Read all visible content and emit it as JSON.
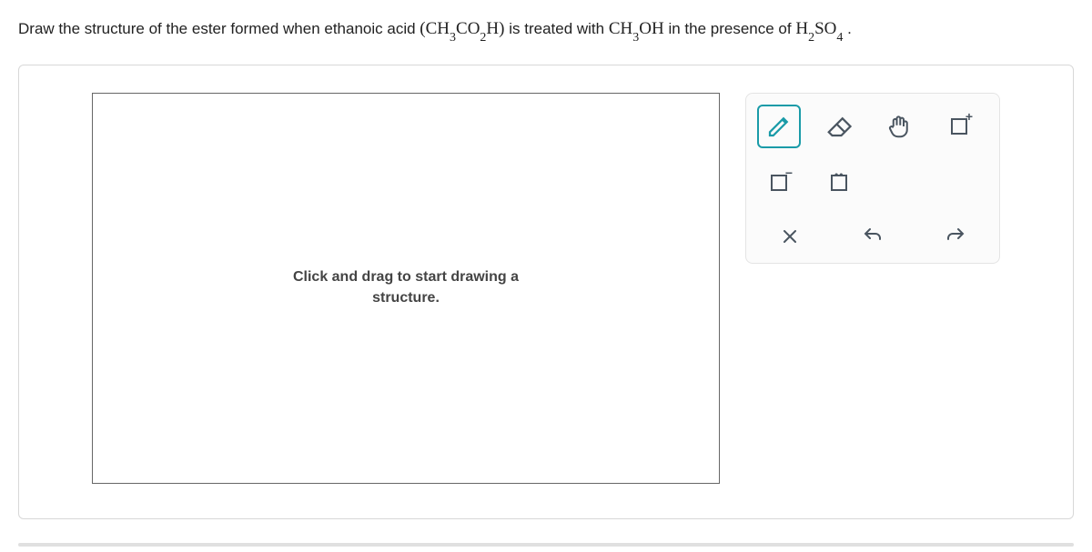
{
  "question": {
    "prefix": "Draw the structure of the ester formed when ethanoic acid ",
    "formula1_open": "(",
    "formula1_part1": "CH",
    "formula1_sub1": "3",
    "formula1_part2": "CO",
    "formula1_sub2": "2",
    "formula1_part3": "H",
    "formula1_close": ")",
    "middle1": " is treated with ",
    "formula2_part1": "CH",
    "formula2_sub1": "3",
    "formula2_part2": "OH",
    "middle2": " in the presence of ",
    "formula3_part1": "H",
    "formula3_sub1": "2",
    "formula3_part2": "SO",
    "formula3_sub2": "4",
    "suffix": "."
  },
  "canvas": {
    "hint_line1": "Click and drag to start drawing a",
    "hint_line2": "structure."
  },
  "tools": {
    "pencil": "pencil",
    "eraser": "eraser",
    "hand": "hand",
    "positive": "+",
    "negative": "−",
    "lonepair": "lone-pair",
    "clear": "clear",
    "undo": "undo",
    "redo": "redo"
  }
}
